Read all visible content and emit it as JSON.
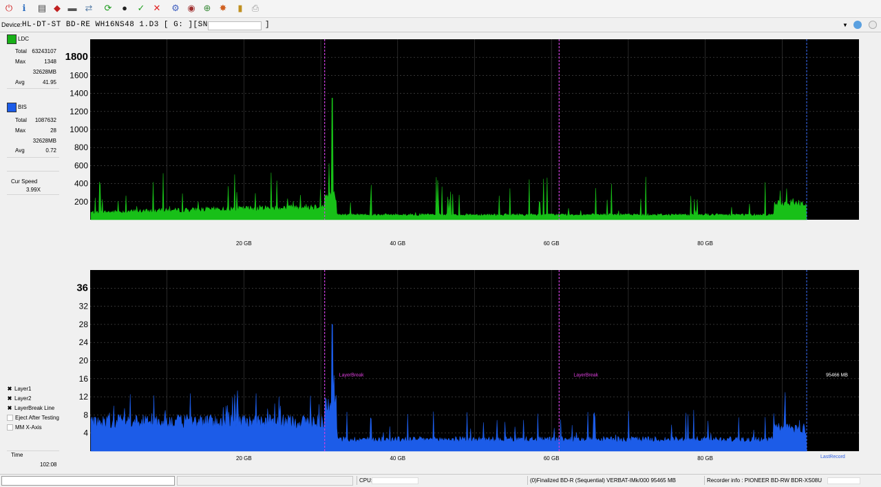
{
  "toolbar": {
    "buttons": [
      {
        "name": "power-icon",
        "glyph": "⏻",
        "color": "#d02020"
      },
      {
        "name": "info-icon",
        "glyph": "ℹ",
        "color": "#3070c0"
      },
      {
        "name": "drive-icon",
        "glyph": "▤",
        "color": "#444"
      },
      {
        "name": "erase-icon",
        "glyph": "◆",
        "color": "#c02020"
      },
      {
        "name": "disc-drive-icon",
        "glyph": "▬",
        "color": "#555"
      },
      {
        "name": "transfer-icon",
        "glyph": "⇄",
        "color": "#5a7fa8"
      },
      {
        "name": "refresh-icon",
        "glyph": "⟳",
        "color": "#1a9a1a"
      },
      {
        "name": "record-icon",
        "glyph": "●",
        "color": "#222"
      },
      {
        "name": "check-icon",
        "glyph": "✓",
        "color": "#20a020"
      },
      {
        "name": "stop-icon",
        "glyph": "✕",
        "color": "#e02020"
      },
      {
        "name": "settings-icon",
        "glyph": "⚙",
        "color": "#4060c0"
      },
      {
        "name": "disc-stack-icon",
        "glyph": "◉",
        "color": "#a03030"
      },
      {
        "name": "target-icon",
        "glyph": "⊕",
        "color": "#3a8a3a"
      },
      {
        "name": "burn-icon",
        "glyph": "✸",
        "color": "#d06020"
      },
      {
        "name": "chart-icon",
        "glyph": "▮",
        "color": "#c09020"
      },
      {
        "name": "print-icon",
        "glyph": "⎙",
        "color": "#999"
      }
    ]
  },
  "device": {
    "label": "Device:",
    "name": "HL-DT-ST BD-RE  WH16NS48  1.D3 [ G: ][SN:",
    "close": "]"
  },
  "stats": {
    "ldc": {
      "label": "LDC",
      "color": "#18b018",
      "total_label": "Total",
      "total": "63243107",
      "max_label": "Max",
      "max": "1348",
      "max_pos": "32628MB",
      "avg_label": "Avg",
      "avg": "41.95"
    },
    "bis": {
      "label": "BIS",
      "color": "#1c5ce8",
      "total_label": "Total",
      "total": "1087632",
      "max_label": "Max",
      "max": "28",
      "max_pos": "32628MB",
      "avg_label": "Avg",
      "avg": "0.72"
    },
    "speed_label": "Cur Speed",
    "speed": "3.99X",
    "time_label": "Time",
    "time": "102:08"
  },
  "options": [
    {
      "label": "Layer1",
      "checked": true
    },
    {
      "label": "Layer2",
      "checked": true
    },
    {
      "label": "LayerBreak Line",
      "checked": true
    },
    {
      "label": "Eject After Testing",
      "checked": false
    },
    {
      "label": "MM X-Axis",
      "checked": false
    }
  ],
  "chart_data": [
    {
      "type": "area",
      "series": [
        {
          "name": "LDC",
          "color": "#18c018"
        }
      ],
      "x_unit": "GB",
      "xlim": [
        0,
        100
      ],
      "ylim": [
        0,
        2000
      ],
      "y_ticks": [
        "200",
        "400",
        "600",
        "800",
        "1000",
        "1200",
        "1400",
        "1600",
        "1800"
      ],
      "x_ticks": [
        "20 GB",
        "40 GB",
        "60 GB",
        "80 GB"
      ],
      "layer_breaks_gb": [
        30.5,
        61.0
      ],
      "end_gb": 93.2,
      "peak": {
        "x": 31.5,
        "y": 1348
      }
    },
    {
      "type": "area",
      "series": [
        {
          "name": "BIS",
          "color": "#1c5ce8"
        }
      ],
      "x_unit": "GB",
      "xlim": [
        0,
        100
      ],
      "ylim": [
        0,
        40
      ],
      "y_ticks": [
        "4",
        "8",
        "12",
        "16",
        "20",
        "24",
        "28",
        "32",
        "36"
      ],
      "x_ticks": [
        "20 GB",
        "40 GB",
        "60 GB",
        "80 GB"
      ],
      "layer_breaks_gb": [
        30.5,
        61.0
      ],
      "layer_break_label": "LayerBreak",
      "end_gb": 93.2,
      "end_label": "95466 MB",
      "last_record_label": "LastRecord",
      "peak": {
        "x": 31.5,
        "y": 28
      }
    }
  ],
  "status": {
    "cpu_label": "CPU:",
    "disc_info": "(0)Finalized  BD-R (Sequential)  VERBAT-IMk/000   95465 MB",
    "recorder_info": "Recorder info : PIONEER     BD-RW  BDR-XS08U"
  }
}
